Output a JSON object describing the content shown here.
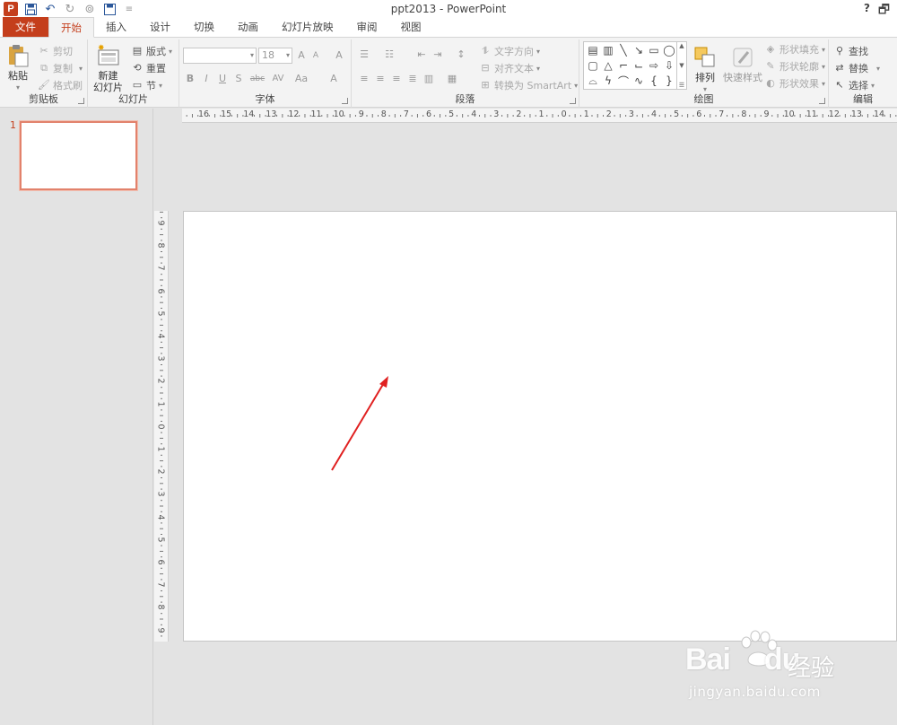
{
  "window": {
    "title": "ppt2013 - PowerPoint",
    "help": "?",
    "restore": "🗗"
  },
  "qat": {
    "logo": "P",
    "save_icon": "save-icon",
    "undo_icon": "undo-icon",
    "redo_icon": "redo-icon",
    "start_icon": "start-from-beginning-icon",
    "customize_icon": "customize-qat-icon"
  },
  "tabs": [
    "文件",
    "开始",
    "插入",
    "设计",
    "切换",
    "动画",
    "幻灯片放映",
    "审阅",
    "视图"
  ],
  "active_tab": "开始",
  "ribbon": {
    "clipboard": {
      "label": "剪贴板",
      "paste": "粘贴",
      "cut": "剪切",
      "copy": "复制",
      "format_painter": "格式刷"
    },
    "slides": {
      "label": "幻灯片",
      "new_slide_line1": "新建",
      "new_slide_line2": "幻灯片",
      "layout": "版式",
      "reset": "重置",
      "section": "节"
    },
    "font": {
      "label": "字体",
      "font_name": "",
      "font_size": "18",
      "grow": "A",
      "shrink": "A",
      "clear": "A",
      "bold": "B",
      "italic": "I",
      "underline": "U",
      "shadow": "S",
      "strike": "abc",
      "spacing": "AV",
      "case": "Aa",
      "color": "A"
    },
    "paragraph": {
      "label": "段落",
      "text_direction": "文字方向",
      "align_text": "对齐文本",
      "smartart": "转换为 SmartArt"
    },
    "drawing": {
      "label": "绘图",
      "arrange": "排列",
      "quick_styles": "快速样式",
      "shape_fill": "形状填充",
      "shape_outline": "形状轮廓",
      "shape_effects": "形状效果"
    },
    "editing": {
      "label": "编辑",
      "find": "查找",
      "replace": "替换",
      "select": "选择"
    }
  },
  "slide_panel": {
    "slides": [
      {
        "number": "1"
      }
    ]
  },
  "rulers": {
    "horizontal": [
      "16",
      "15",
      "14",
      "13",
      "12",
      "11",
      "10",
      "9",
      "8",
      "7",
      "6",
      "5",
      "4",
      "3",
      "2",
      "1",
      "0",
      "1",
      "2",
      "3",
      "4",
      "5",
      "6",
      "7",
      "8",
      "9",
      "10",
      "11",
      "12",
      "13",
      "14"
    ],
    "vertical": [
      "9",
      "8",
      "7",
      "6",
      "5",
      "4",
      "3",
      "2",
      "1",
      "0",
      "1",
      "2",
      "3",
      "4",
      "5",
      "6",
      "7",
      "8",
      "9"
    ]
  },
  "annotation": {
    "arrow_color": "#e02020"
  },
  "watermark": {
    "logo": "Bai",
    "logo2": "du",
    "cn": "经验",
    "url": "jingyan.baidu.com"
  },
  "colors": {
    "accent": "#c43e1c",
    "tab_bg": "#ffffff",
    "ribbon_bg": "#f3f3f3",
    "workspace": "#e3e3e3"
  }
}
